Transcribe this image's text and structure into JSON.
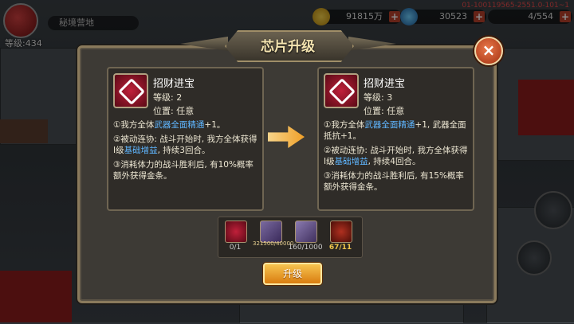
{
  "hud": {
    "level": "等级:434",
    "place": "秘境营地",
    "gold": "91815万",
    "diamonds": "30523",
    "stamina": "4/554",
    "build_id": "01-100119565-2551.0-101~1"
  },
  "dialog": {
    "title": "芯片升级",
    "close_label": "×",
    "before": {
      "name": "招财进宝",
      "level": "等级: 2",
      "position": "位置: 任意",
      "line1_a": "①我方全体",
      "line1_hl": "武器全面精通",
      "line1_b": "+1。",
      "line2_a": "②被动连协: 战斗开始时, 我方全体获得Ⅰ级",
      "line2_hl": "基础增益",
      "line2_b": ", 持续3回合。",
      "line3": "③消耗体力的战斗胜利后, 有10%概率额外获得金条。"
    },
    "after": {
      "name": "招财进宝",
      "level": "等级: 3",
      "position": "位置: 任意",
      "line1_a": "①我方全体",
      "line1_hl": "武器全面精通",
      "line1_b": "+1, 武器全面抵抗+1。",
      "line2_a": "②被动连协: 战斗开始时, 我方全体获得Ⅰ级",
      "line2_hl": "基础增益",
      "line2_b": ", 持续4回合。",
      "line3": "③消耗体力的战斗胜利后, 有15%概率额外获得金条。"
    },
    "materials": [
      {
        "count": "0/1",
        "icon": "chip-gem-icon"
      },
      {
        "count": "321500/40000",
        "icon": "gold-bars-icon"
      },
      {
        "count": "160/1000",
        "icon": "silver-box-icon"
      },
      {
        "count": "67/11",
        "icon": "magnifier-icon"
      }
    ],
    "upgrade_label": "升级"
  }
}
